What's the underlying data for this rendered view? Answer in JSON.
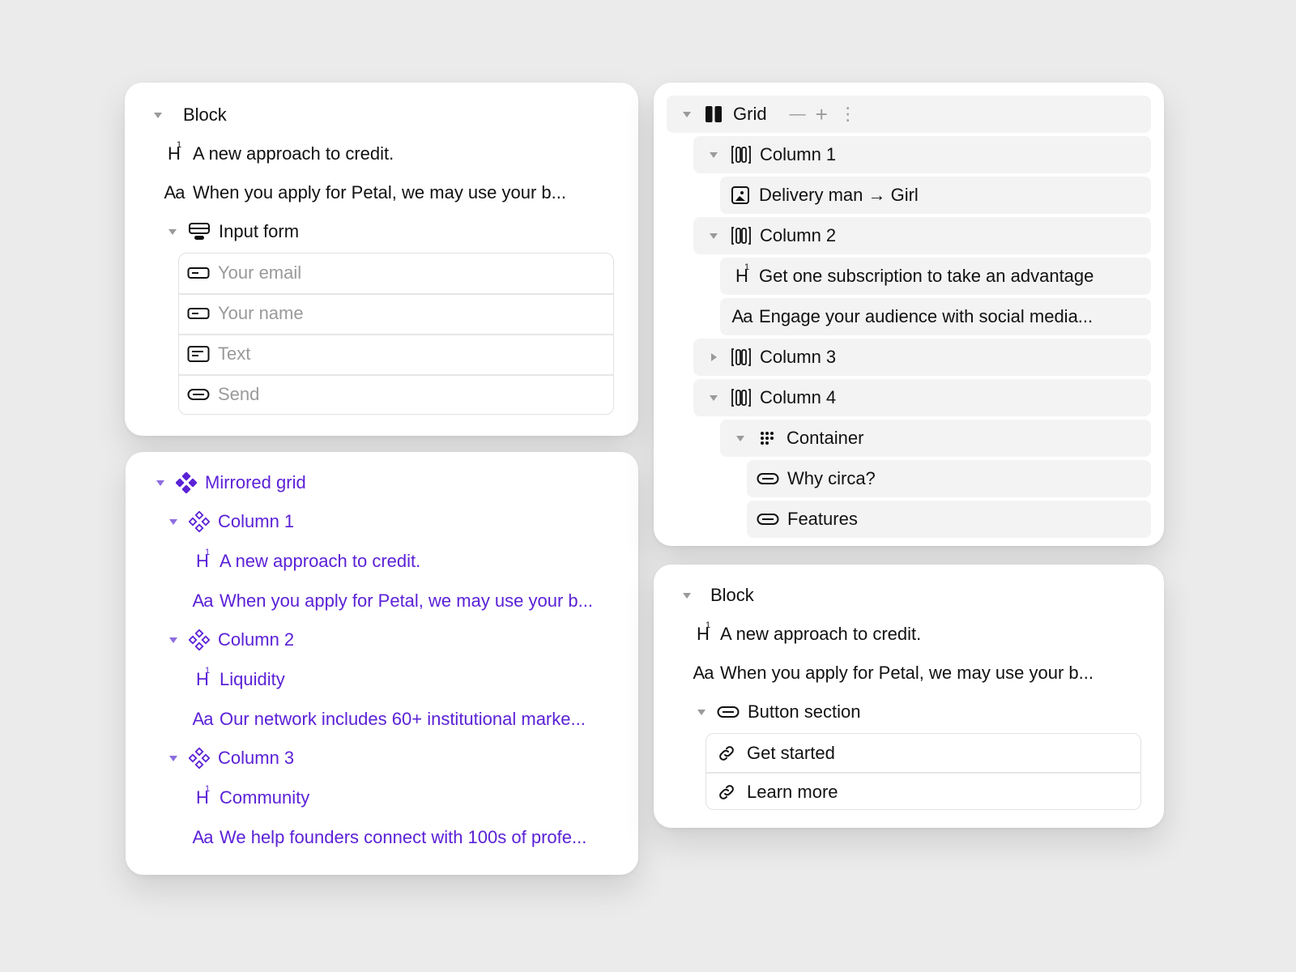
{
  "panel_block_top": {
    "title": "Block",
    "heading": "A new approach to credit.",
    "body": "When you apply for Petal, we may use your b...",
    "form_label": "Input form",
    "fields": [
      {
        "icon": "input-field-icon",
        "placeholder": "Your email"
      },
      {
        "icon": "input-field-icon",
        "placeholder": "Your name"
      },
      {
        "icon": "textarea-icon",
        "placeholder": "Text"
      },
      {
        "icon": "button-icon",
        "placeholder": "Send"
      }
    ]
  },
  "panel_mirrored": {
    "title": "Mirrored grid",
    "accent": "#5b21d6",
    "columns": [
      {
        "label": "Column 1",
        "heading": "A new approach to credit.",
        "body": "When you apply for Petal, we may use your b..."
      },
      {
        "label": "Column 2",
        "heading": "Liquidity",
        "body": "Our network includes 60+ institutional marke..."
      },
      {
        "label": "Column 3",
        "heading": "Community",
        "body": "We help founders connect with 100s of profe..."
      }
    ]
  },
  "panel_grid": {
    "title": "Grid",
    "minus": "—",
    "plus": "+",
    "more": "⋮",
    "col1": "Column 1",
    "col1_image": "Delivery man → Girl",
    "col2": "Column 2",
    "col2_heading": "Get one subscription to take an advantage",
    "col2_body": "Engage your audience with social media...",
    "col3": "Column 3",
    "col4": "Column 4",
    "container": "Container",
    "link1": "Why circa?",
    "link2": "Features"
  },
  "panel_block_bottom": {
    "title": "Block",
    "heading": "A new approach to credit.",
    "body": "When you apply for Petal, we may use your b...",
    "section": "Button section",
    "buttons": [
      "Get started",
      "Learn more"
    ]
  }
}
